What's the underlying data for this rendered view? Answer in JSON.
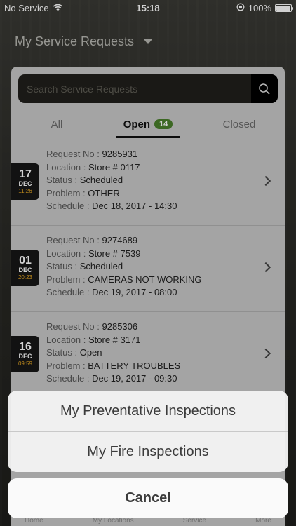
{
  "status_bar": {
    "carrier": "No Service",
    "time": "15:18",
    "battery": "100%"
  },
  "header": {
    "title": "My Service Requests"
  },
  "search": {
    "placeholder": "Search Service Requests"
  },
  "tabs": [
    {
      "label": "All"
    },
    {
      "label": "Open",
      "badge": "14"
    },
    {
      "label": "Closed"
    }
  ],
  "labels": {
    "request_no": "Request No :",
    "location": "Location :",
    "status": "Status :",
    "problem": "Problem :",
    "schedule": "Schedule :"
  },
  "requests": [
    {
      "day": "17",
      "month": "DEC",
      "time": "11:26",
      "request_no": "9285931",
      "location": "Store # 0117",
      "status": "Scheduled",
      "problem": "OTHER",
      "schedule": "Dec 18, 2017 - 14:30"
    },
    {
      "day": "01",
      "month": "DEC",
      "time": "20:23",
      "request_no": "9274689",
      "location": "Store # 7539",
      "status": "Scheduled",
      "problem": "CAMERAS NOT WORKING",
      "schedule": "Dec 19, 2017 - 08:00"
    },
    {
      "day": "16",
      "month": "DEC",
      "time": "09:59",
      "request_no": "9285306",
      "location": "Store # 3171",
      "status": "Open",
      "problem": "BATTERY TROUBLES",
      "schedule": "Dec 19, 2017 - 09:30"
    }
  ],
  "tabbar": {
    "items": [
      "Home",
      "My Locations",
      "Service",
      "More"
    ]
  },
  "action_sheet": {
    "option1": "My Preventative Inspections",
    "option2": "My Fire Inspections",
    "cancel": "Cancel"
  },
  "colors": {
    "badge": "#4a7f2b",
    "date_time": "#e5a624"
  }
}
